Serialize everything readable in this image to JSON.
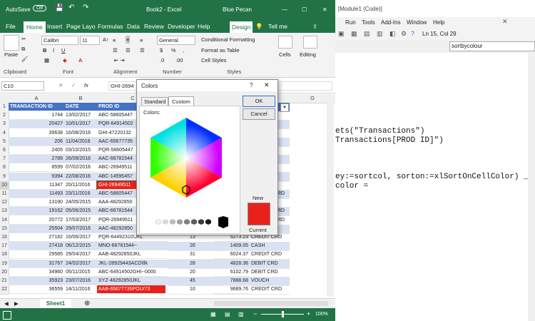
{
  "excel": {
    "autosave_label": "AutoSave",
    "autosave_state": "Off",
    "title": "Book2 - Excel",
    "user": "Blue Pecan",
    "tabs": [
      "File",
      "Home",
      "Insert",
      "Page Layo",
      "Formulas",
      "Data",
      "Review",
      "Developer",
      "Help",
      "Design"
    ],
    "tell_me": "Tell me",
    "ribbon": {
      "paste": "Paste",
      "clipboard": "Clipboard",
      "font_name": "Calibri",
      "font_size": "11",
      "font_group": "Font",
      "alignment": "Alignment",
      "number_format": "General",
      "number": "Number",
      "conditional_formatting": "Conditional Formatting",
      "format_as_table": "Format as Table",
      "cell_styles": "Cell Styles",
      "styles": "Styles",
      "cells": "Cells",
      "editing": "Editing",
      "percent": "%"
    },
    "name_box": "C10",
    "fx": "fx",
    "formula_value": "GHI-2694",
    "columns": [
      "A",
      "B",
      "C",
      "G"
    ],
    "headers": [
      "TRANSACTION ID",
      "DATE",
      "PROD ID"
    ],
    "rows": [
      {
        "n": "2",
        "id": "1744",
        "date": "13/02/2017",
        "prod": "ABC-58605447"
      },
      {
        "n": "3",
        "id": "20427",
        "date": "10/01/2017",
        "prod": "PQR-64914502"
      },
      {
        "n": "4",
        "id": "39638",
        "date": "16/08/2016",
        "prod": "GHI-47220132"
      },
      {
        "n": "5",
        "id": "206",
        "date": "11/04/2016",
        "prod": "AAC-65677735"
      },
      {
        "n": "6",
        "id": "2405",
        "date": "03/10/2015",
        "prod": "PQR-58605447"
      },
      {
        "n": "7",
        "id": "2789",
        "date": "26/09/2016",
        "prod": "AAC-66781544"
      },
      {
        "n": "8",
        "id": "8599",
        "date": "07/02/2016",
        "prod": "ABC-26949511"
      },
      {
        "n": "9",
        "id": "9394",
        "date": "22/08/2016",
        "prod": "ABC-14595457"
      },
      {
        "n": "10",
        "id": "11347",
        "date": "20/11/2016",
        "prod": "GHI-26949511",
        "red": true
      },
      {
        "n": "11",
        "id": "11493",
        "date": "23/11/2016",
        "prod": "ABC-58605447",
        "e": "RD"
      },
      {
        "n": "12",
        "id": "13190",
        "date": "24/05/2015",
        "prod": "AAA-48292850"
      },
      {
        "n": "13",
        "id": "19162",
        "date": "05/06/2015",
        "prod": "ABC-66781544",
        "e": "RD"
      },
      {
        "n": "14",
        "id": "20772",
        "date": "17/03/2017",
        "prod": "PQR-26949511",
        "e": "RD"
      },
      {
        "n": "15",
        "id": "25504",
        "date": "29/07/2016",
        "prod": "AAC-48292850"
      },
      {
        "n": "16",
        "id": "27182",
        "date": "16/06/2017",
        "prod": "PQR-64492310\\JKL",
        "d": "13",
        "e2": "5273.23",
        "f": "CREDIT CRD"
      },
      {
        "n": "17",
        "id": "27418",
        "date": "06/12/2015",
        "prod": "MNO-66781544~",
        "d": "26",
        "e2": "1409.05",
        "f": "CASH"
      },
      {
        "n": "18",
        "id": "29585",
        "date": "29/04/2017",
        "prod": "AAB-48292850JKL",
        "d": "31",
        "e2": "6024.37",
        "f": "CREDIT CRD"
      },
      {
        "n": "19",
        "id": "31767",
        "date": "24/02/2017",
        "prod": "JKL-28929443ACD\\llk",
        "d": "28",
        "e2": "4828.36",
        "f": "DEBIT CRD"
      },
      {
        "n": "20",
        "id": "34960",
        "date": "05/11/2015",
        "prod": "ABC-64914502GHI--0000",
        "d": "20",
        "e2": "6102.79",
        "f": "DEBIT CRD"
      },
      {
        "n": "21",
        "id": "35923",
        "date": "23/07/2016",
        "prod": "XYZ-48292850JKL",
        "d": "45",
        "e2": "7888.68",
        "f": "VOUCH"
      },
      {
        "n": "22",
        "id": "36559",
        "date": "14/11/2016",
        "prod": "AAB-65677735POU/73",
        "d": "10",
        "e2": "9689.76",
        "f": "CREDIT CRD",
        "red": true
      }
    ],
    "sheet_tab": "Sheet1",
    "zoom": "100%"
  },
  "vba": {
    "title": "[Module1 (Code)]",
    "menu": [
      "Run",
      "Tools",
      "Add-Ins",
      "Window",
      "Help"
    ],
    "position": "Ln 15, Col 29",
    "procedure": "sortbycolour",
    "code": [
      "ets(\"Transactions\")",
      "Transactions[PROD ID]\")",
      "ey:=sortcol, sorton:=xlSortOnCellColor) _",
      "color ="
    ]
  },
  "dialog": {
    "title": "Colors",
    "help": "?",
    "close": "✕",
    "tabs": [
      "Standard",
      "Custom"
    ],
    "colors_label": "Colors:",
    "ok": "OK",
    "cancel": "Cancel",
    "new_label": "New",
    "current_label": "Current",
    "new_color": "#e8221a"
  }
}
